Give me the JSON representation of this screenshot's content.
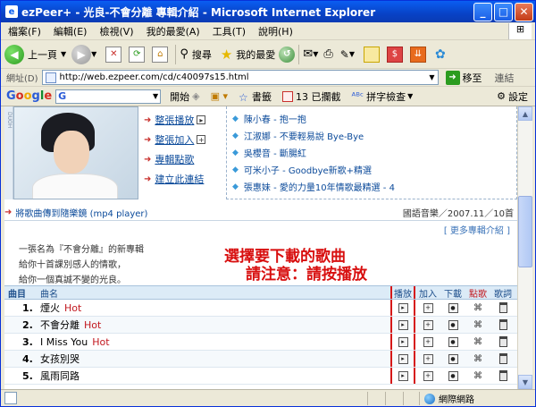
{
  "window": {
    "title": "ezPeer+ - 光良-不會分離 專輯介紹 - Microsoft Internet Explorer",
    "controls": {
      "minimize": "_",
      "maximize": "□",
      "close": "✕"
    }
  },
  "menubar": {
    "items": [
      "檔案(F)",
      "編輯(E)",
      "檢視(V)",
      "我的最愛(A)",
      "工具(T)",
      "說明(H)"
    ]
  },
  "toolbar": {
    "back_label": "上一頁",
    "search_label": "搜尋",
    "favorites_label": "我的最愛"
  },
  "addressbar": {
    "label": "網址(D)",
    "url": "http://web.ezpeer.com/cd/c40097s15.html",
    "go_label": "移至",
    "links_label": "連結"
  },
  "googlebar": {
    "logo": [
      "G",
      "o",
      "o",
      "g",
      "l",
      "e"
    ],
    "search_prefix": "G",
    "start_label": "開始",
    "bookmarks_label": "書籤",
    "blocked_label": "13 已攔截",
    "spell_label": "拼字檢查",
    "settings_label": "設定"
  },
  "album": {
    "strip_text": "DUOH",
    "actions": [
      {
        "label": "整張播放",
        "has_plus": true
      },
      {
        "label": "整張加入",
        "has_plus": true
      },
      {
        "label": "專輯點歌",
        "has_plus": false
      },
      {
        "label": "建立此連結",
        "has_plus": false
      }
    ],
    "related": [
      "陳小春 - 抱一抱",
      "江淑娜 - 不要輕易說 Bye-Bye",
      "吳櫻音 - 斷腸紅",
      "可米小子 - Goodbye新歌+精選",
      "張惠妹 - 愛的力量10年情歌最精選 - 4"
    ],
    "mp4_link": "將歌曲傳到隨樂鏡 (mp4 player)",
    "label_info": "國語音樂／2007.11／10首",
    "more_link": "[ 更多專輯介紹 ]",
    "description": [
      "一張名為『不會分離』的新專輯",
      "給你十首課別感人的情歌，",
      "給你一個真誠不變的光良。"
    ]
  },
  "annotation": {
    "line1": "選擇要下載的歌曲",
    "line2": "請注意：請按播放"
  },
  "song_table": {
    "headers": {
      "num": "曲目",
      "name": "曲名",
      "play": "播放",
      "add": "加入",
      "download": "下載",
      "request": "點歌",
      "lyrics": "歌詞"
    },
    "rows": [
      {
        "num": "1.",
        "name": "煙火",
        "hot": "Hot"
      },
      {
        "num": "2.",
        "name": "不會分離",
        "hot": "Hot"
      },
      {
        "num": "3.",
        "name": "I Miss You",
        "hot": "Hot"
      },
      {
        "num": "4.",
        "name": "女孩別哭",
        "hot": ""
      },
      {
        "num": "5.",
        "name": "風雨同路",
        "hot": ""
      }
    ]
  },
  "statusbar": {
    "zone_label": "網際網路"
  },
  "colors": {
    "title_blue": "#0842c6",
    "annotation_red": "#d80f0f",
    "link_blue": "#0b4a9a",
    "hot_red": "#c2181f"
  }
}
